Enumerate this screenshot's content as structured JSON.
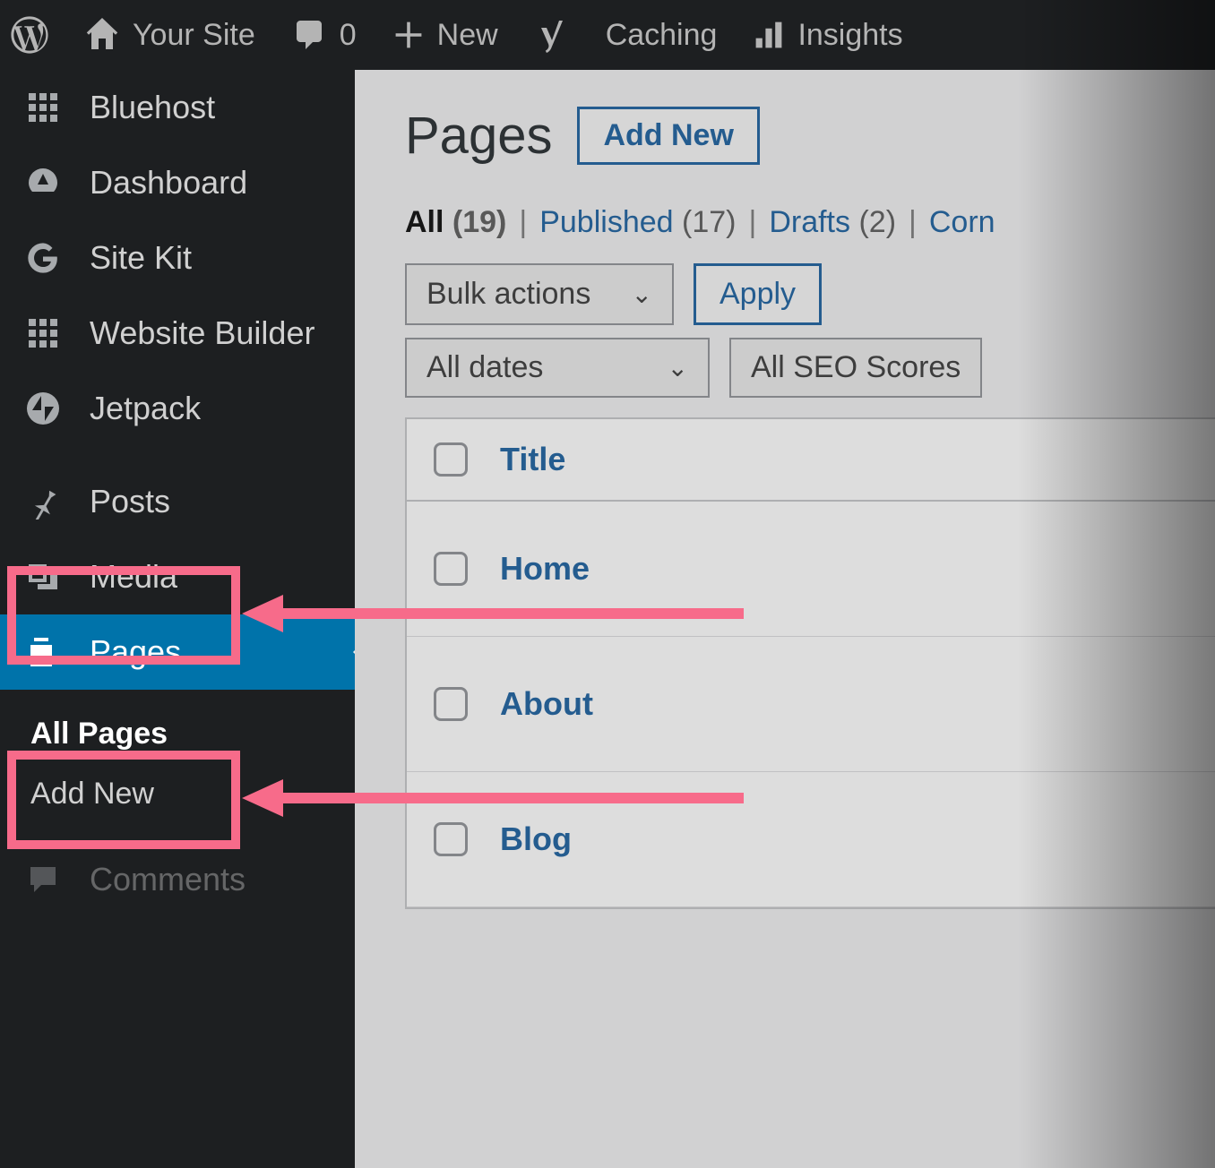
{
  "adminbar": {
    "site_label": "Your Site",
    "comments_count": "0",
    "new_label": "New",
    "caching_label": "Caching",
    "insights_label": "Insights"
  },
  "sidebar": {
    "items": [
      {
        "id": "bluehost",
        "label": "Bluehost"
      },
      {
        "id": "dashboard",
        "label": "Dashboard"
      },
      {
        "id": "sitekit",
        "label": "Site Kit"
      },
      {
        "id": "website-builder",
        "label": "Website Builder"
      },
      {
        "id": "jetpack",
        "label": "Jetpack"
      },
      {
        "id": "posts",
        "label": "Posts"
      },
      {
        "id": "media",
        "label": "Media"
      },
      {
        "id": "pages",
        "label": "Pages"
      },
      {
        "id": "comments",
        "label": "Comments"
      }
    ],
    "pages_submenu": {
      "all_pages": "All Pages",
      "add_new": "Add New"
    }
  },
  "main": {
    "title": "Pages",
    "add_new": "Add New",
    "filters": {
      "all_label": "All",
      "all_count": "(19)",
      "published_label": "Published",
      "published_count": "(17)",
      "drafts_label": "Drafts",
      "drafts_count": "(2)",
      "cornerstone_label": "Corn"
    },
    "bulk_actions": "Bulk actions",
    "apply": "Apply",
    "all_dates": "All dates",
    "all_seo": "All SEO Scores",
    "table": {
      "title_header": "Title",
      "rows": [
        "Home",
        "About",
        "Blog"
      ]
    }
  },
  "annotations": {
    "highlight_color": "#f76b8a"
  }
}
